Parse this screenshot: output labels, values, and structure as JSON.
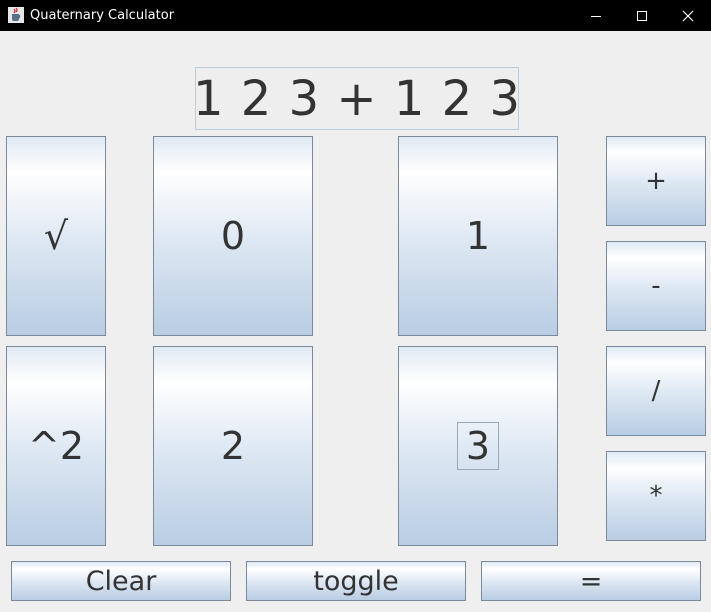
{
  "window": {
    "title": "Quaternary Calculator",
    "icons": {
      "app": "java-cup-icon",
      "minimize": "minimize-icon",
      "maximize": "maximize-icon",
      "close": "close-icon"
    }
  },
  "display": {
    "value": "1 2 3 + 1 2 3"
  },
  "keypad": {
    "sqrt": "√",
    "square": "^2",
    "digit_0": "0",
    "digit_1": "1",
    "digit_2": "2",
    "digit_3": "3"
  },
  "operators": {
    "add": "+",
    "subtract": "-",
    "divide": "/",
    "multiply": "*"
  },
  "actions": {
    "clear": "Clear",
    "toggle": "toggle",
    "equals": "="
  }
}
